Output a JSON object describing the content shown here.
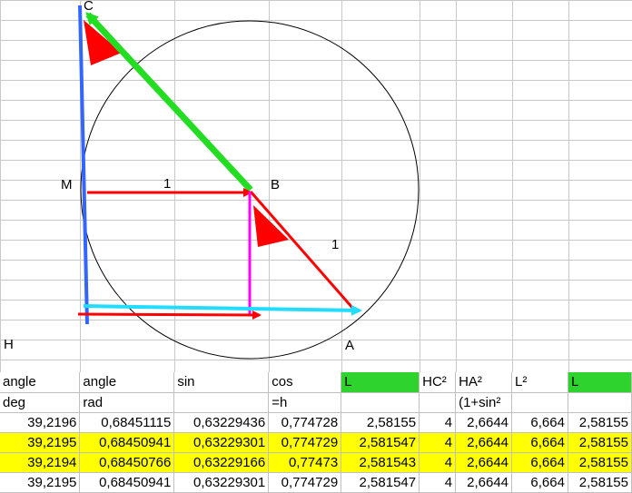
{
  "diagram": {
    "point_labels": {
      "C": "C",
      "M": "M",
      "B": "B",
      "H": "H",
      "A": "A"
    },
    "length_labels": {
      "MB": "1",
      "BA": "1"
    },
    "colors": {
      "grid": "#c8c8c8",
      "circle": "#000000",
      "hc_line": "#3366ff",
      "cb_arrow": "#22dd22",
      "mb_arrow": "#ff0000",
      "ba_line": "#ff0000",
      "vertical": "#ff00ff",
      "ha_arrow": "#22ddff",
      "bottom_arrow": "#ff0000",
      "angle_mark": "#ff0000"
    }
  },
  "table": {
    "header1": [
      "angle",
      "angle",
      "sin",
      "cos",
      "L",
      "HC²",
      "HA²",
      "L²",
      "L"
    ],
    "header2": [
      "deg",
      "rad",
      "",
      "=h",
      "",
      "",
      "(1+sin²",
      "",
      ""
    ],
    "rows": [
      {
        "highlight": false,
        "cells": [
          "39,2196",
          "0,68451115",
          "0,63229436",
          "0,774728",
          "2,58155",
          "4",
          "2,6644",
          "6,664",
          "2,58155"
        ]
      },
      {
        "highlight": true,
        "cells": [
          "39,2195",
          "0,68450941",
          "0,63229301",
          "0,774729",
          "2,581547",
          "4",
          "2,6644",
          "6,664",
          "2,58155"
        ]
      },
      {
        "highlight": true,
        "cells": [
          "39,2194",
          "0,68450766",
          "0,63229166",
          "0,77473",
          "2,581543",
          "4",
          "2,6644",
          "6,664",
          "2,58155"
        ]
      },
      {
        "highlight": false,
        "cells": [
          "39,2195",
          "0,68450941",
          "0,63229301",
          "0,774729",
          "2,581547",
          "4",
          "2,6644",
          "6,664",
          "2,58155"
        ]
      }
    ],
    "green_header_cols": [
      4,
      8
    ],
    "highlight_color": "#ffff00",
    "green_color": "#2ed32e"
  }
}
